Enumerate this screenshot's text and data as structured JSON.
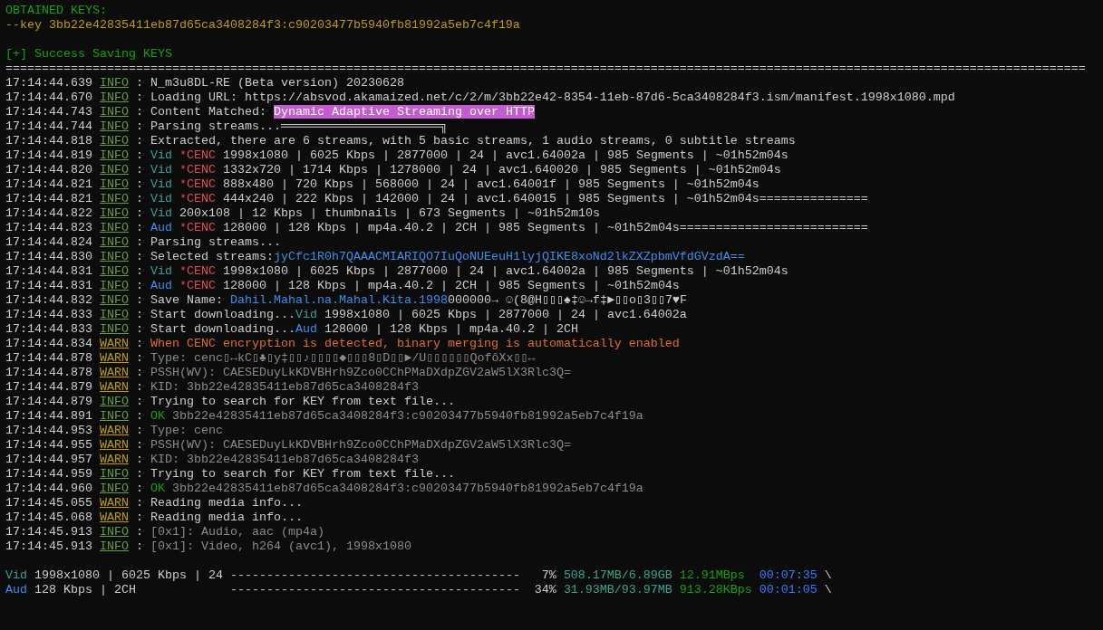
{
  "obtained_keys": {
    "title": "OBTAINED KEYS:",
    "key": "--key 3bb22e42835411eb87d65ca3408284f3:c90203477b5940fb81992a5eb7c4f19a"
  },
  "status": "[+] Success Saving KEYS",
  "separator": "=====================================================================================================================================================",
  "log": [
    {
      "time": "17:14:44.639",
      "tag": "INFO",
      "kind": "info",
      "parts": [
        {
          "text": ": N_m3u8DL-RE (Beta version) 20230628",
          "kind": "plain"
        }
      ]
    },
    {
      "time": "17:14:44.670",
      "tag": "INFO",
      "kind": "info",
      "parts": [
        {
          "text": ": Loading URL: https://absvod.akamaized.net/c/2/m/3bb22e42-8354-11eb-87d6-5ca3408284f3.ism/manifest.1998x1080.mpd",
          "kind": "plain"
        }
      ]
    },
    {
      "time": "17:14:44.743",
      "tag": "INFO",
      "kind": "info",
      "parts": [
        {
          "text": ": Content Matched: ",
          "kind": "plain"
        },
        {
          "text": "Dynamic Adaptive Streaming over HTTP",
          "kind": "highlight"
        }
      ]
    },
    {
      "time": "17:14:44.744",
      "tag": "INFO",
      "kind": "info",
      "parts": [
        {
          "text": ": Parsing streams...══════════════════════╗",
          "kind": "plain"
        }
      ]
    },
    {
      "time": "17:14:44.818",
      "tag": "INFO",
      "kind": "info",
      "parts": [
        {
          "text": ": Extracted, there are 6 streams, with 5 basic streams, 1 audio streams, 0 subtitle streams",
          "kind": "plain"
        }
      ]
    },
    {
      "time": "17:14:44.819",
      "tag": "INFO",
      "kind": "info",
      "parts": [
        {
          "text": ": ",
          "kind": "plain"
        },
        {
          "text": "Vid",
          "kind": "vid"
        },
        {
          "text": "*CENC",
          "kind": "cenc"
        },
        {
          "text": "1998x1080 | 6025 Kbps | 2877000 | 24 | avc1.64002a | 985 Segments | ~01h52m04s",
          "kind": "plain"
        }
      ]
    },
    {
      "time": "17:14:44.820",
      "tag": "INFO",
      "kind": "info",
      "parts": [
        {
          "text": ": ",
          "kind": "plain"
        },
        {
          "text": "Vid",
          "kind": "vid"
        },
        {
          "text": "*CENC",
          "kind": "cenc"
        },
        {
          "text": "1332x720 | 1714 Kbps | 1278000 | 24 | avc1.640020 | 985 Segments | ~01h52m04s",
          "kind": "plain"
        }
      ]
    },
    {
      "time": "17:14:44.821",
      "tag": "INFO",
      "kind": "info",
      "parts": [
        {
          "text": ": ",
          "kind": "plain"
        },
        {
          "text": "Vid",
          "kind": "vid"
        },
        {
          "text": "*CENC",
          "kind": "cenc"
        },
        {
          "text": "888x480 | 720 Kbps | 568000 | 24 | avc1.64001f | 985 Segments | ~01h52m04s",
          "kind": "plain"
        }
      ]
    },
    {
      "time": "17:14:44.821",
      "tag": "INFO",
      "kind": "info",
      "parts": [
        {
          "text": ": ",
          "kind": "plain"
        },
        {
          "text": "Vid",
          "kind": "vid"
        },
        {
          "text": "*CENC",
          "kind": "cenc"
        },
        {
          "text": "444x240 | 222 Kbps | 142000 | 24 | avc1.640015 | 985 Segments | ~01h52m04s===============",
          "kind": "plain"
        }
      ]
    },
    {
      "time": "17:14:44.822",
      "tag": "INFO",
      "kind": "info",
      "parts": [
        {
          "text": ": ",
          "kind": "plain"
        },
        {
          "text": "Vid",
          "kind": "vid"
        },
        {
          "text": "200x108 | 12 Kbps | thumbnails | 673 Segments | ~01h52m10s",
          "kind": "plain"
        }
      ]
    },
    {
      "time": "17:14:44.823",
      "tag": "INFO",
      "kind": "info",
      "parts": [
        {
          "text": ": ",
          "kind": "plain"
        },
        {
          "text": "Aud",
          "kind": "aud"
        },
        {
          "text": "*CENC",
          "kind": "cenc"
        },
        {
          "text": "128000 | 128 Kbps | mp4a.40.2 | 2CH | 985 Segments | ~01h52m04s==========================",
          "kind": "plain"
        }
      ]
    },
    {
      "time": "17:14:44.824",
      "tag": "INFO",
      "kind": "info",
      "parts": [
        {
          "text": ": Parsing streams...",
          "kind": "plain"
        }
      ]
    },
    {
      "time": "17:14:44.830",
      "tag": "INFO",
      "kind": "info",
      "parts": [
        {
          "text": ": Selected streams:",
          "kind": "plain"
        },
        {
          "text": "jyCfc1R0h7QAAACMIARIQO7IuQoNUEeuH1lyjQIKE8xoNd2lkZXZpbmVfdGVzdA==",
          "kind": "link"
        }
      ]
    },
    {
      "time": "17:14:44.831",
      "tag": "INFO",
      "kind": "info",
      "parts": [
        {
          "text": ": ",
          "kind": "plain"
        },
        {
          "text": "Vid",
          "kind": "vid"
        },
        {
          "text": "*CENC",
          "kind": "cenc"
        },
        {
          "text": "1998x1080 | 6025 Kbps | 2877000 | 24 | avc1.64002a | 985 Segments | ~01h52m04s",
          "kind": "plain"
        }
      ]
    },
    {
      "time": "17:14:44.831",
      "tag": "INFO",
      "kind": "info",
      "parts": [
        {
          "text": ": ",
          "kind": "plain"
        },
        {
          "text": "Aud",
          "kind": "aud"
        },
        {
          "text": "*CENC",
          "kind": "cenc"
        },
        {
          "text": "128000 | 128 Kbps | mp4a.40.2 | 2CH | 985 Segments | ~01h52m04s",
          "kind": "plain"
        }
      ]
    },
    {
      "time": "17:14:44.832",
      "tag": "INFO",
      "kind": "info",
      "parts": [
        {
          "text": ": Save Name: ",
          "kind": "plain"
        },
        {
          "text": "Dahil.Mahal.na.Mahal.Kita.1998",
          "kind": "link"
        },
        {
          "text": "000000→ ☺(8@H▯▯▯♠‡☺→f‡►▯▯o▯3▯▯7♥F",
          "kind": "plain"
        }
      ]
    },
    {
      "time": "17:14:44.833",
      "tag": "INFO",
      "kind": "info",
      "parts": [
        {
          "text": ": Start downloading...",
          "kind": "plain"
        },
        {
          "text": "Vid",
          "kind": "vid"
        },
        {
          "text": "1998x1080 | 6025 Kbps | 2877000 | 24 | avc1.64002a",
          "kind": "plain"
        }
      ]
    },
    {
      "time": "17:14:44.833",
      "tag": "INFO",
      "kind": "info",
      "parts": [
        {
          "text": ": Start downloading...",
          "kind": "plain"
        },
        {
          "text": "Aud",
          "kind": "aud"
        },
        {
          "text": "128000 | 128 Kbps | mp4a.40.2 | 2CH",
          "kind": "plain"
        }
      ]
    },
    {
      "time": "17:14:44.834",
      "tag": "WARN",
      "kind": "warn",
      "parts": [
        {
          "text": ": ",
          "kind": "plain"
        },
        {
          "text": "When CENC encryption is detected, binary merging is automatically enabled",
          "kind": "warn"
        }
      ]
    },
    {
      "time": "17:14:44.878",
      "tag": "WARN",
      "kind": "warn",
      "parts": [
        {
          "text": ": ",
          "kind": "plain"
        },
        {
          "text": "Type: cenc▯↔kC▯♣▯y‡▯▯♪▯▯▯▯◆▯▯▯8▯D▯▯►/U▯▯▯▯▯▯QofôXx▯▯↔",
          "kind": "dim"
        }
      ]
    },
    {
      "time": "17:14:44.878",
      "tag": "WARN",
      "kind": "warn",
      "parts": [
        {
          "text": ": ",
          "kind": "plain"
        },
        {
          "text": "PSSH(WV): CAESEDuyLkKDVBHrh9Zco0CChPMaDXdpZGV2aW5lX3Rlc3Q=",
          "kind": "dim"
        }
      ]
    },
    {
      "time": "17:14:44.879",
      "tag": "WARN",
      "kind": "warn",
      "parts": [
        {
          "text": ": ",
          "kind": "plain"
        },
        {
          "text": "KID: 3bb22e42835411eb87d65ca3408284f3",
          "kind": "dim"
        }
      ]
    },
    {
      "time": "17:14:44.879",
      "tag": "INFO",
      "kind": "info",
      "parts": [
        {
          "text": ": Trying to search for KEY from text file...",
          "kind": "plain"
        }
      ]
    },
    {
      "time": "17:14:44.891",
      "tag": "INFO",
      "kind": "info",
      "parts": [
        {
          "text": ": ",
          "kind": "plain"
        },
        {
          "text": "OK",
          "kind": "ok"
        },
        {
          "text": "3bb22e42835411eb87d65ca3408284f3:c90203477b5940fb81992a5eb7c4f19a",
          "kind": "dim"
        }
      ]
    },
    {
      "time": "17:14:44.953",
      "tag": "WARN",
      "kind": "warn",
      "parts": [
        {
          "text": ": ",
          "kind": "plain"
        },
        {
          "text": "Type: cenc",
          "kind": "dim"
        }
      ]
    },
    {
      "time": "17:14:44.955",
      "tag": "WARN",
      "kind": "warn",
      "parts": [
        {
          "text": ": ",
          "kind": "plain"
        },
        {
          "text": "PSSH(WV): CAESEDuyLkKDVBHrh9Zco0CChPMaDXdpZGV2aW5lX3Rlc3Q=",
          "kind": "dim"
        }
      ]
    },
    {
      "time": "17:14:44.957",
      "tag": "WARN",
      "kind": "warn",
      "parts": [
        {
          "text": ": ",
          "kind": "plain"
        },
        {
          "text": "KID: 3bb22e42835411eb87d65ca3408284f3",
          "kind": "dim"
        }
      ]
    },
    {
      "time": "17:14:44.959",
      "tag": "INFO",
      "kind": "info",
      "parts": [
        {
          "text": ": Trying to search for KEY from text file...",
          "kind": "plain"
        }
      ]
    },
    {
      "time": "17:14:44.960",
      "tag": "INFO",
      "kind": "info",
      "parts": [
        {
          "text": ": ",
          "kind": "plain"
        },
        {
          "text": "OK",
          "kind": "ok"
        },
        {
          "text": "3bb22e42835411eb87d65ca3408284f3:c90203477b5940fb81992a5eb7c4f19a",
          "kind": "dim"
        }
      ]
    },
    {
      "time": "17:14:45.055",
      "tag": "WARN",
      "kind": "warn",
      "parts": [
        {
          "text": ": Reading media info...",
          "kind": "plain"
        }
      ]
    },
    {
      "time": "17:14:45.068",
      "tag": "WARN",
      "kind": "warn",
      "parts": [
        {
          "text": ": Reading media info...",
          "kind": "plain"
        }
      ]
    },
    {
      "time": "17:14:45.913",
      "tag": "INFO",
      "kind": "info",
      "parts": [
        {
          "text": ": ",
          "kind": "plain"
        },
        {
          "text": "[0x1]: Audio, aac (mp4a)",
          "kind": "dim"
        }
      ]
    },
    {
      "time": "17:14:45.913",
      "tag": "INFO",
      "kind": "info",
      "parts": [
        {
          "text": ": ",
          "kind": "plain"
        },
        {
          "text": "[0x1]: Video, h264 (avc1), 1998x1080",
          "kind": "dim"
        }
      ]
    }
  ],
  "progress": [
    {
      "parts": [
        {
          "text": "Vid",
          "kind": "vid"
        },
        {
          "text": "1998x1080 | 6025 Kbps | 24 ----------------------------------------   7%",
          "kind": "plain"
        },
        {
          "text": "508.17MB/6.89GB",
          "kind": "size"
        },
        {
          "text": "12.91MBps",
          "kind": "speed"
        },
        {
          "text": " 00:07:35",
          "kind": "time"
        },
        {
          "text": "\\",
          "kind": "plain"
        }
      ]
    },
    {
      "parts": [
        {
          "text": "Aud",
          "kind": "aud"
        },
        {
          "text": "128 Kbps | 2CH             ----------------------------------------  34%",
          "kind": "plain"
        },
        {
          "text": "31.93MB/93.97MB",
          "kind": "size"
        },
        {
          "text": "913.28KBps",
          "kind": "speed"
        },
        {
          "text": "00:01:05",
          "kind": "time"
        },
        {
          "text": "\\",
          "kind": "plain"
        }
      ]
    }
  ]
}
